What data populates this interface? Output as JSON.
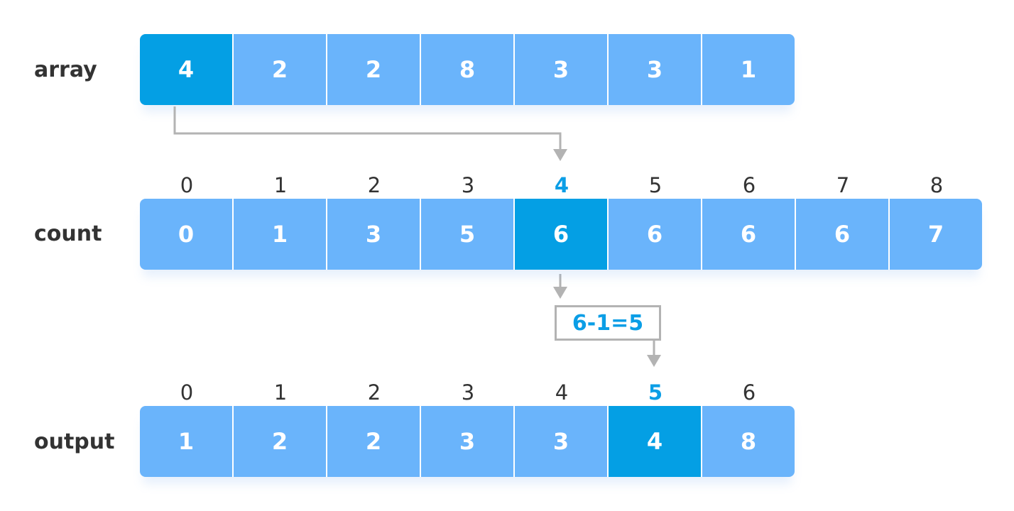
{
  "rows": {
    "array": {
      "label": "array",
      "values": [
        "4",
        "2",
        "2",
        "8",
        "3",
        "3",
        "1"
      ],
      "highlight": 0
    },
    "count": {
      "label": "count",
      "indices": [
        "0",
        "1",
        "2",
        "3",
        "4",
        "5",
        "6",
        "7",
        "8"
      ],
      "values": [
        "0",
        "1",
        "3",
        "5",
        "6",
        "6",
        "6",
        "6",
        "7"
      ],
      "highlight": 4
    },
    "output": {
      "label": "output",
      "indices": [
        "0",
        "1",
        "2",
        "3",
        "4",
        "5",
        "6"
      ],
      "values": [
        "1",
        "2",
        "2",
        "3",
        "3",
        "4",
        "8"
      ],
      "highlight": 5
    }
  },
  "calculation": "6-1=5",
  "colors": {
    "cell": "#6ab4fb",
    "highlight": "#049fe4",
    "accent_text": "#0b9ee6",
    "arrow": "#b3b3b3"
  }
}
